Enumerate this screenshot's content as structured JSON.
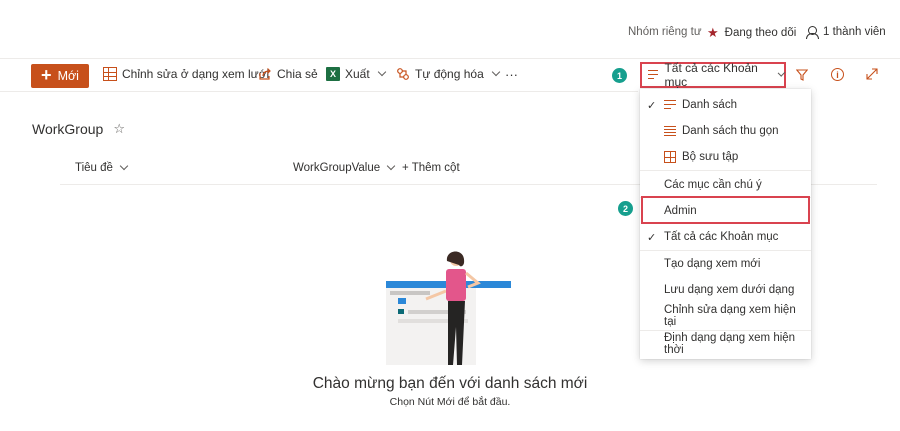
{
  "header": {
    "privacy": "Nhóm riêng tư",
    "following": "Đang theo dõi",
    "members": "1 thành viên"
  },
  "commandbar": {
    "new_label": "Mới",
    "edit_grid_label": "Chỉnh sửa ở dạng xem lưới",
    "share_label": "Chia sẻ",
    "export_label": "Xuất",
    "automate_label": "Tự động hóa",
    "more_label": "···",
    "view_selector_label": "Tất cả các Khoản mục"
  },
  "annotations": {
    "badge1": "1",
    "badge2": "2"
  },
  "list": {
    "title": "WorkGroup",
    "columns": [
      "Tiêu đề",
      "WorkGroupValue"
    ],
    "add_column": "+ Thêm cột"
  },
  "empty_state": {
    "title": "Chào mừng bạn đến với danh sách mới",
    "subtitle": "Chọn Nút Mới để bắt đầu."
  },
  "view_menu": {
    "items": [
      {
        "label": "Danh sách",
        "checked": true,
        "icon": "list-icon"
      },
      {
        "label": "Danh sách thu gọn",
        "checked": false,
        "icon": "compact-list-icon"
      },
      {
        "label": "Bộ sưu tập",
        "checked": false,
        "icon": "gallery-icon"
      },
      {
        "label": "Các mục cần chú ý",
        "checked": false
      },
      {
        "label": "Admin",
        "checked": false,
        "highlighted": true
      },
      {
        "label": "Tất cả các Khoản mục",
        "checked": true
      },
      {
        "label": "Tạo dạng xem mới",
        "checked": false
      },
      {
        "label": "Lưu dạng xem dưới dạng",
        "checked": false
      },
      {
        "label": "Chỉnh sửa dạng xem hiện tại",
        "checked": false
      },
      {
        "label": "Định dạng dạng xem hiện thời",
        "checked": false
      }
    ]
  },
  "colors": {
    "accent": "#c7501b",
    "highlight_border": "#d9434f",
    "badge": "#169f8e"
  }
}
